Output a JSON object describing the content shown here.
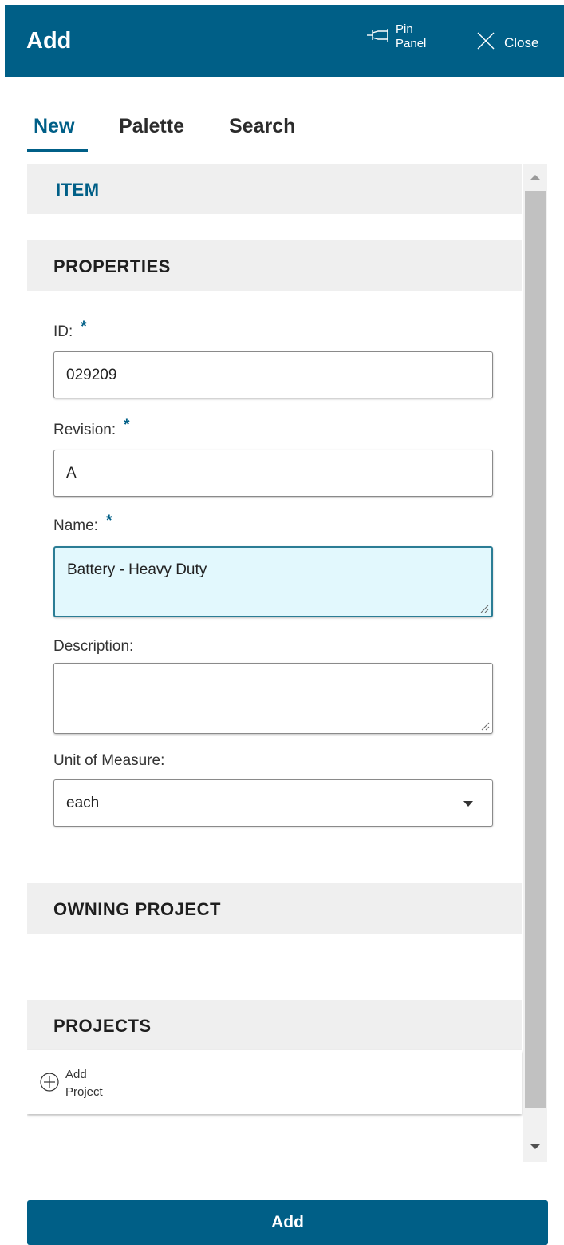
{
  "header": {
    "title": "Add",
    "pin_label": "Pin Panel",
    "close_label": "Close",
    "background_color": "#005f87"
  },
  "tabs": [
    {
      "label": "New",
      "active": true
    },
    {
      "label": "Palette",
      "active": false
    },
    {
      "label": "Search",
      "active": false
    }
  ],
  "sections": {
    "item": "ITEM",
    "properties": "PROPERTIES",
    "owning_project": "OWNING PROJECT",
    "projects": "PROJECTS"
  },
  "form": {
    "required_marker": "*",
    "id": {
      "label": "ID:",
      "value": "029209",
      "required": true
    },
    "revision": {
      "label": "Revision:",
      "value": "A",
      "required": true
    },
    "name": {
      "label": "Name:",
      "value": "Battery - Heavy Duty",
      "required": true
    },
    "description": {
      "label": "Description:",
      "value": ""
    },
    "unit_of_measure": {
      "label": "Unit of Measure:",
      "value": "each"
    }
  },
  "projects": {
    "add_project_label": "Add Project",
    "add_icon": "plus-circle-icon"
  },
  "footer": {
    "add_button_label": "Add"
  },
  "colors": {
    "accent": "#005f87",
    "focus_field_bg": "#e2f8fd",
    "section_bg": "#efefef"
  }
}
